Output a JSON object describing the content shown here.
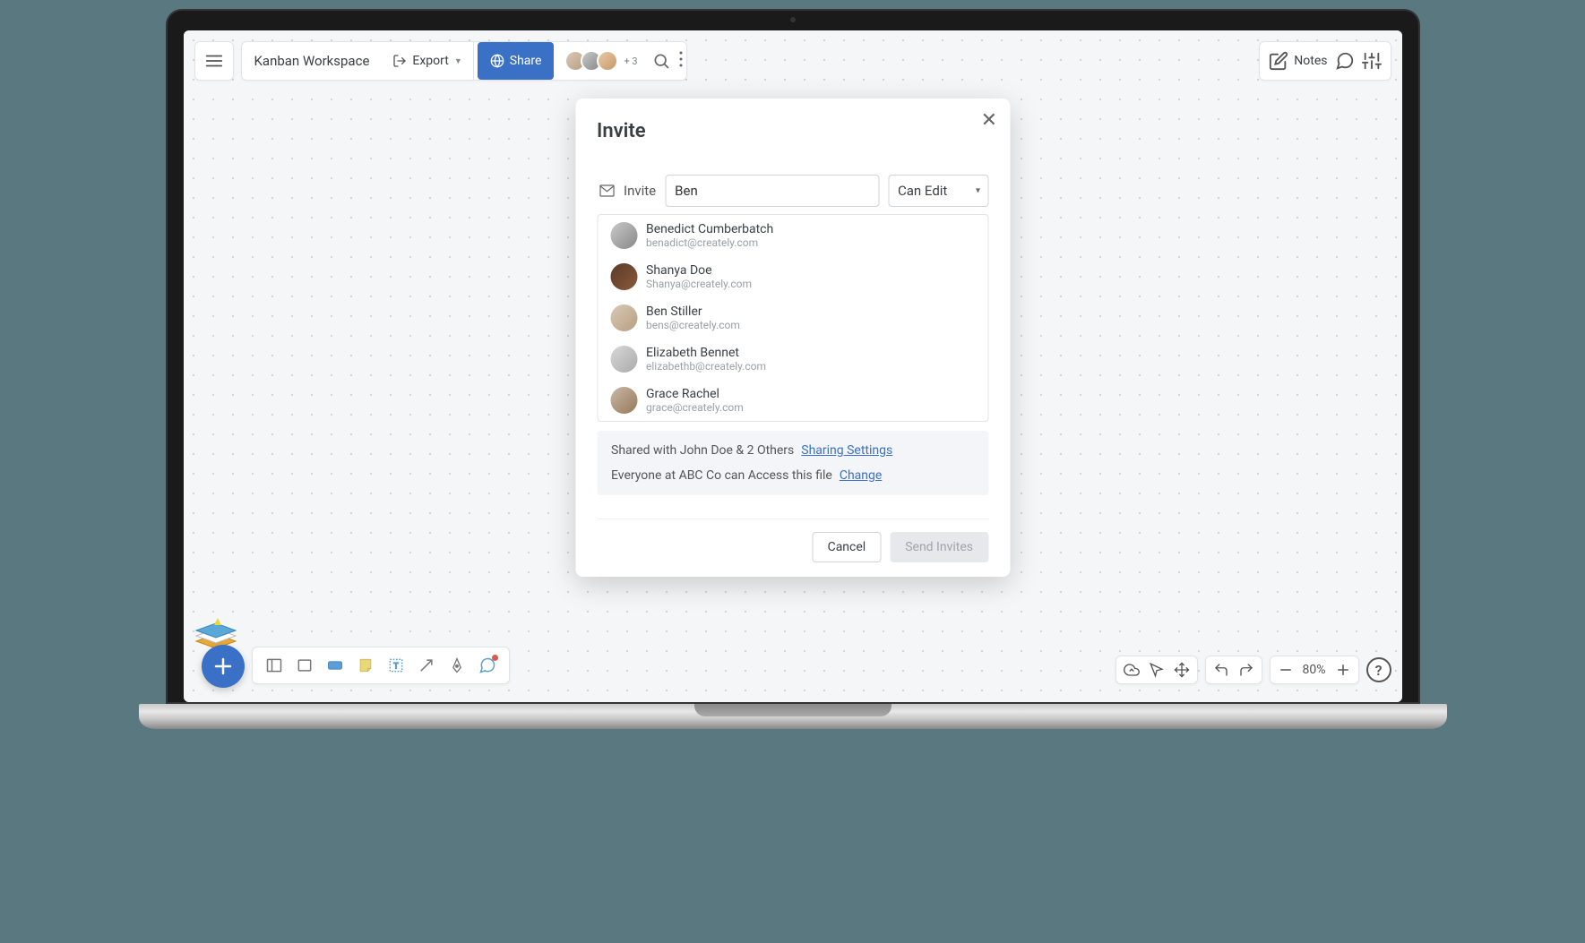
{
  "header": {
    "workspace_title": "Kanban Workspace",
    "export_label": "Export",
    "share_label": "Share",
    "additional_count": "+ 3",
    "notes_label": "Notes"
  },
  "modal": {
    "title": "Invite",
    "invite_label": "Invite",
    "input_value": "Ben",
    "input_placeholder": "",
    "permission": "Can Edit",
    "suggestions": [
      {
        "name": "Benedict Cumberbatch",
        "email": "benadict@creately.com"
      },
      {
        "name": "Shanya Doe",
        "email": "Shanya@creately.com"
      },
      {
        "name": "Ben Stiller",
        "email": "bens@creately.com"
      },
      {
        "name": "Elizabeth Bennet",
        "email": "elizabethb@creately.com"
      },
      {
        "name": "Grace Rachel",
        "email": "grace@creately.com"
      }
    ],
    "shared_with_text": "Shared with John Doe & 2 Others",
    "sharing_settings_link": "Sharing Settings",
    "org_access_text": "Everyone at ABC Co can Access this file",
    "change_link": "Change",
    "cancel_label": "Cancel",
    "send_label": "Send Invites"
  },
  "footer": {
    "zoom": "80%",
    "help": "?"
  }
}
